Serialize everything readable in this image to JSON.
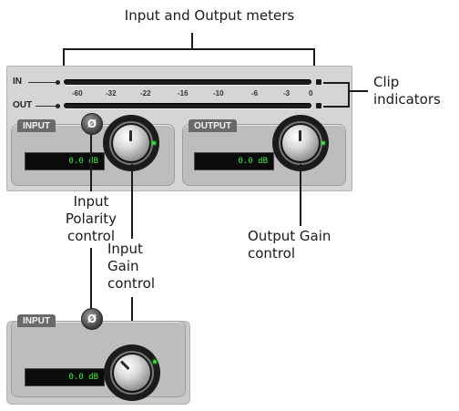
{
  "callouts": {
    "meters": "Input and Output meters",
    "clip_line1": "Clip",
    "clip_line2": "indicators",
    "polarity_line1": "Input",
    "polarity_line2": "Polarity",
    "polarity_line3": "control",
    "input_gain_line1": "Input",
    "input_gain_line2": "Gain",
    "input_gain_line3": "control",
    "output_gain_line1": "Output Gain",
    "output_gain_line2": "control"
  },
  "meters": {
    "in_label": "IN",
    "out_label": "OUT",
    "scale": [
      "-60",
      "-32",
      "-22",
      "-16",
      "-10",
      "-6",
      "-3",
      "0"
    ]
  },
  "input_section": {
    "title": "INPUT",
    "polarity_symbol": "Ø",
    "gain_display": "0.0 dB"
  },
  "output_section": {
    "title": "OUTPUT",
    "gain_display": "0.0 dB"
  },
  "detail": {
    "title": "INPUT",
    "polarity_symbol": "Ø",
    "gain_display": "0.0 dB"
  },
  "colors": {
    "lcd_text": "#3cf03c",
    "knob_led": "#33e033",
    "panel": "#d5d5d5"
  }
}
